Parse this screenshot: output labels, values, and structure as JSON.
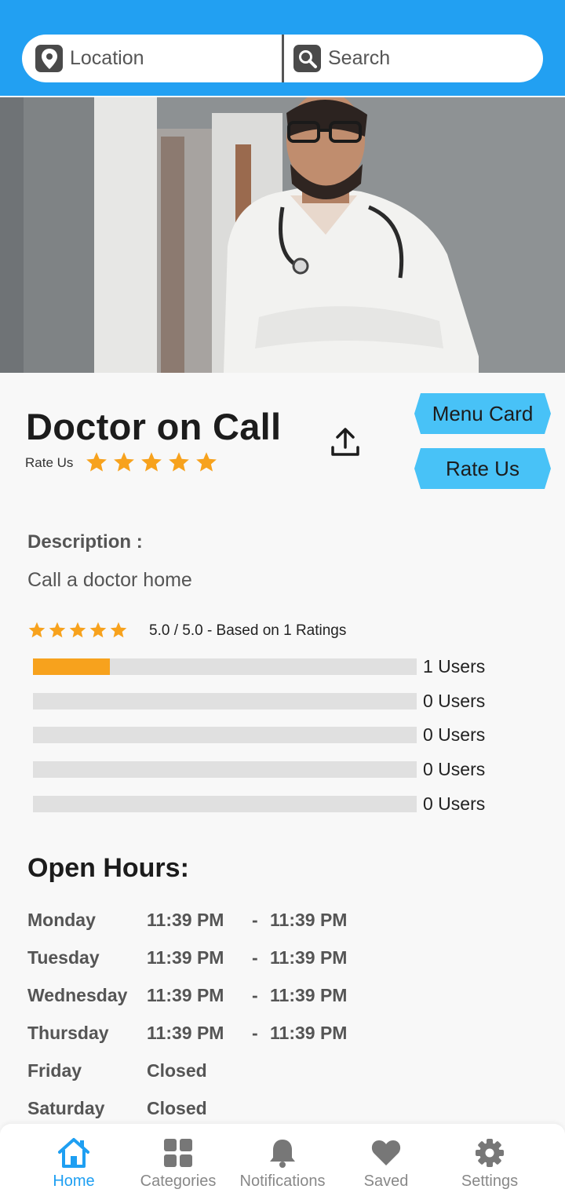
{
  "colors": {
    "primary": "#22a0f2",
    "accent_button": "#48c2f7",
    "star": "#f7a21d"
  },
  "search_bar": {
    "location_label": "Location",
    "location_icon": "map-pin-icon",
    "search_label": "Search",
    "search_icon": "search-icon"
  },
  "hero": {
    "image": "doctor-photo"
  },
  "listing": {
    "title": "Doctor on Call",
    "rate_label": "Rate Us",
    "rating_stars": 5,
    "menu_card_button": "Menu Card",
    "rate_us_button": "Rate Us",
    "share_icon": "share-upload-icon"
  },
  "description": {
    "label": "Description :",
    "text": "Call a doctor home"
  },
  "ratings": {
    "stars": 5,
    "summary": "5.0 / 5.0 - Based on 1 Ratings",
    "bars": [
      {
        "fill": 0.2,
        "count": "1 Users"
      },
      {
        "fill": 0,
        "count": "0 Users"
      },
      {
        "fill": 0,
        "count": "0 Users"
      },
      {
        "fill": 0,
        "count": "0 Users"
      },
      {
        "fill": 0,
        "count": "0 Users"
      }
    ]
  },
  "open_hours": {
    "title": "Open Hours:",
    "rows": [
      {
        "day": "Monday",
        "open": "11:39 PM",
        "dash": "-",
        "close": "11:39 PM"
      },
      {
        "day": "Tuesday",
        "open": "11:39 PM",
        "dash": "-",
        "close": "11:39 PM"
      },
      {
        "day": "Wednesday",
        "open": "11:39 PM",
        "dash": "-",
        "close": "11:39 PM"
      },
      {
        "day": "Thursday",
        "open": "11:39 PM",
        "dash": "-",
        "close": "11:39 PM"
      },
      {
        "day": "Friday",
        "open": "Closed",
        "dash": "",
        "close": ""
      },
      {
        "day": "Saturday",
        "open": "Closed",
        "dash": "",
        "close": ""
      }
    ]
  },
  "bottom_nav": {
    "items": [
      {
        "label": "Home",
        "icon": "home-icon",
        "active": true
      },
      {
        "label": "Categories",
        "icon": "grid-icon",
        "active": false
      },
      {
        "label": "Notifications",
        "icon": "bell-icon",
        "active": false
      },
      {
        "label": "Saved",
        "icon": "heart-icon",
        "active": false
      },
      {
        "label": "Settings",
        "icon": "gear-icon",
        "active": false
      }
    ]
  }
}
